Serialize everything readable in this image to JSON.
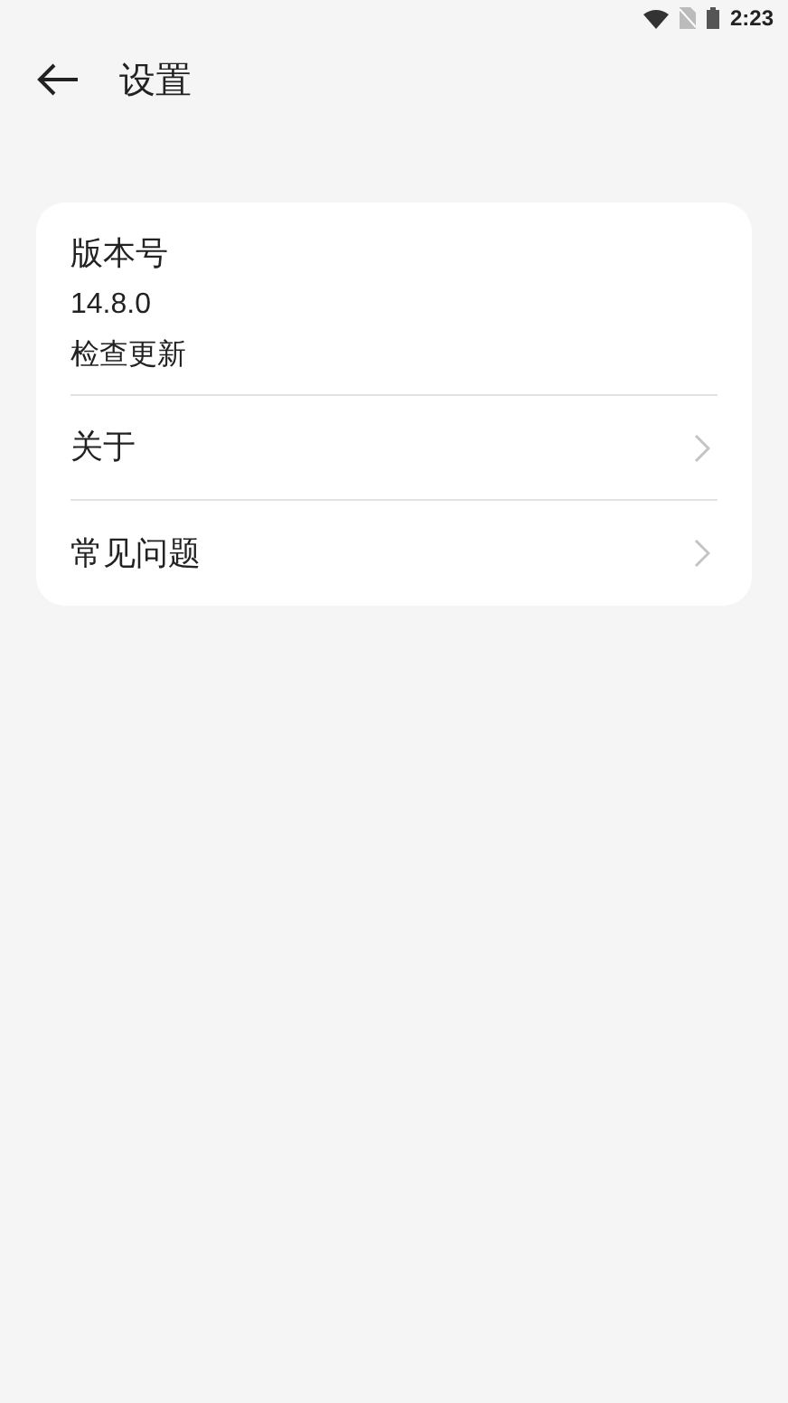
{
  "status_bar": {
    "time": "2:23"
  },
  "header": {
    "title": "设置"
  },
  "version": {
    "label": "版本号",
    "value": "14.8.0",
    "action": "检查更新"
  },
  "items": [
    {
      "label": "关于"
    },
    {
      "label": "常见问题"
    }
  ]
}
